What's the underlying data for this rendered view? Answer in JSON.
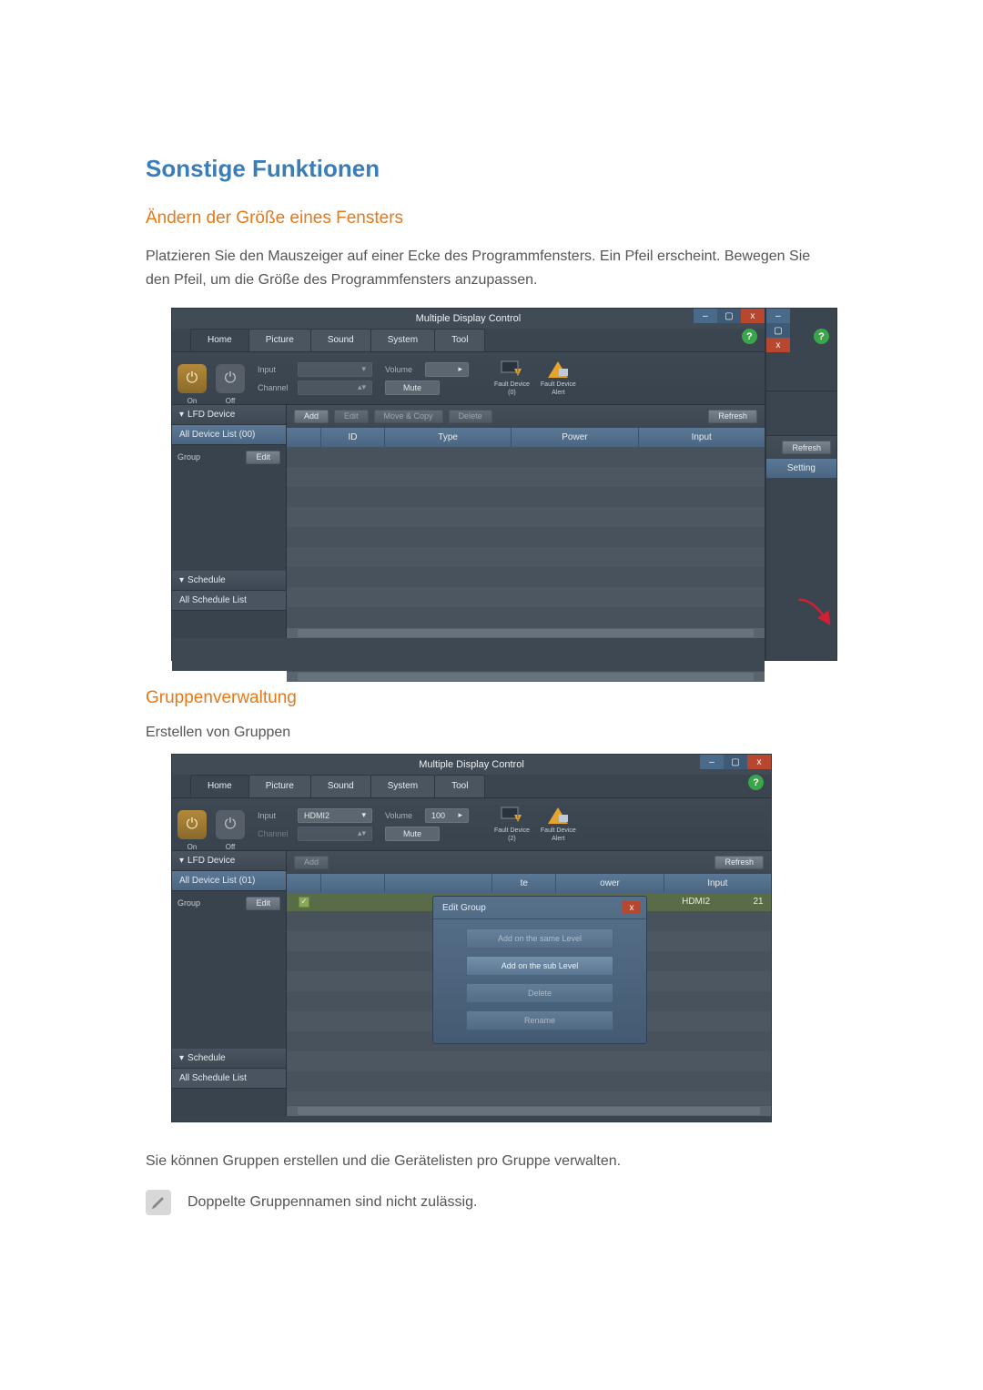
{
  "headings": {
    "main": "Sonstige Funktionen",
    "sub1": "Ändern der Größe eines Fensters",
    "sub2": "Gruppenverwaltung",
    "sub3": "Erstellen von Gruppen"
  },
  "paragraphs": {
    "p1": "Platzieren Sie den Mauszeiger auf einer Ecke des Programmfensters. Ein Pfeil erscheint. Bewegen Sie den Pfeil, um die Größe des Programmfensters anzupassen.",
    "p2": "Sie können Gruppen erstellen und die Gerätelisten pro Gruppe verwalten.",
    "note": "Doppelte Gruppennamen sind nicht zulässig."
  },
  "app": {
    "title": "Multiple Display Control",
    "tabs": [
      "Home",
      "Picture",
      "Sound",
      "System",
      "Tool"
    ],
    "power": {
      "on": "On",
      "off": "Off"
    },
    "toolbar": {
      "input_label": "Input",
      "input_value": "HDMI2",
      "channel_label": "Channel",
      "volume_label": "Volume",
      "volume_value": "100",
      "mute": "Mute"
    },
    "fault": {
      "device_label": "Fault Device",
      "device_count_a": "(0)",
      "device_count_b": "(2)",
      "alert_label": "Fault Device\nAlert"
    },
    "sidebar": {
      "lfd": "LFD Device",
      "all_list_a": "All Device List (00)",
      "all_list_b": "All Device List (01)",
      "group": "Group",
      "edit": "Edit",
      "schedule": "Schedule",
      "all_schedule": "All Schedule List"
    },
    "actions": {
      "add": "Add",
      "edit": "Edit",
      "move_copy": "Move & Copy",
      "delete": "Delete",
      "refresh": "Refresh"
    },
    "columns": {
      "id": "ID",
      "type": "Type",
      "power": "Power",
      "input": "Input",
      "setting": "Setting"
    },
    "popup": {
      "title": "Edit Group",
      "same_level": "Add on the same Level",
      "sub_level": "Add on the sub Level",
      "delete": "Delete",
      "rename": "Rename"
    },
    "row": {
      "hdmi2": "HDMI2",
      "num": "21"
    }
  }
}
